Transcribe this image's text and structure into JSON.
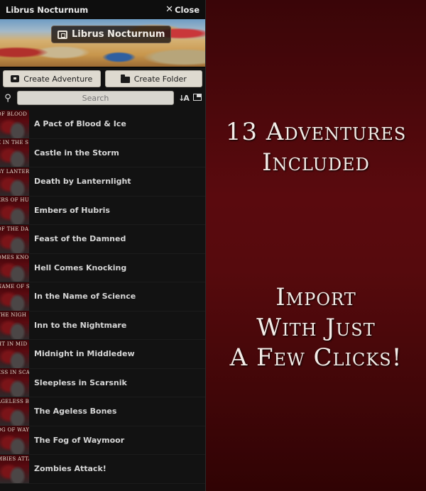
{
  "panel": {
    "title": "Librus Nocturnum",
    "close_label": "Close",
    "banner_label": "Librus Nocturnum",
    "buttons": {
      "create_adventure": "Create Adventure",
      "create_folder": "Create Folder"
    },
    "search": {
      "placeholder": "Search",
      "value": ""
    },
    "icons": {
      "search": "search-icon",
      "sort": "sort-icon",
      "collapse": "collapse-folders-icon",
      "close": "close-icon"
    },
    "adventures": [
      {
        "title": "A Pact of Blood & Ice",
        "thumb_text": "OF BLOOD"
      },
      {
        "title": "Castle in the Storm",
        "thumb_text": "E IN THE S"
      },
      {
        "title": "Death by Lanternlight",
        "thumb_text": "BY LANTER"
      },
      {
        "title": "Embers of Hubris",
        "thumb_text": "ERS OF HU"
      },
      {
        "title": "Feast of the Damned",
        "thumb_text": "OF THE DA"
      },
      {
        "title": "Hell Comes Knocking",
        "thumb_text": "OMES KNO"
      },
      {
        "title": "In the Name of Science",
        "thumb_text": "NAME OF S"
      },
      {
        "title": "Inn to the Nightmare",
        "thumb_text": "THE NIGH"
      },
      {
        "title": "Midnight in Middledew",
        "thumb_text": "HT IN MID"
      },
      {
        "title": "Sleepless in Scarsnik",
        "thumb_text": "ESS IN SCA"
      },
      {
        "title": "The Ageless Bones",
        "thumb_text": "AGELESS B"
      },
      {
        "title": "The Fog of Waymoor",
        "thumb_text": "OG OF WAY"
      },
      {
        "title": "Zombies Attack!",
        "thumb_text": "MBIES ATTA"
      }
    ]
  },
  "promo": {
    "heading_1": [
      "13 Adventures",
      "Included"
    ],
    "heading_2": [
      "Import",
      "With Just",
      "A Few Clicks!"
    ]
  },
  "colors": {
    "panel_bg": "#121212",
    "promo_bg": "#560a0d",
    "button_bg": "#dedad0"
  }
}
